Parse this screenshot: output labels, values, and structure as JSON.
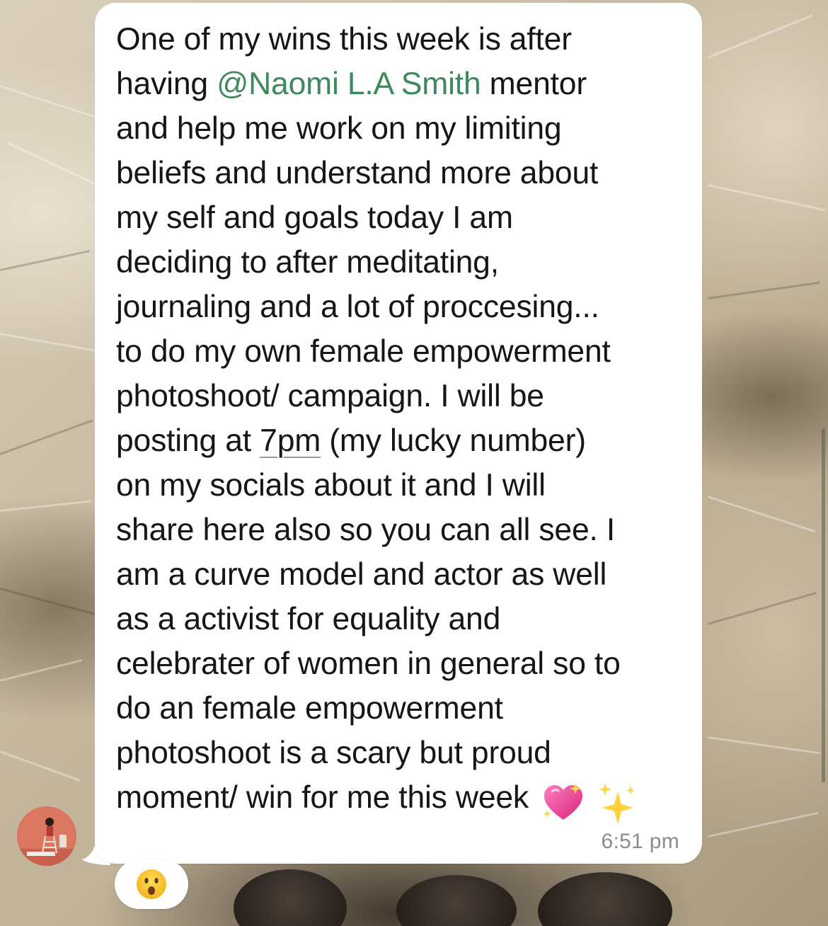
{
  "message": {
    "line_1": "One of my wins this week is after",
    "line_2_before": "having ",
    "mention": "@Naomi L.A Smith",
    "line_2_after": " mentor",
    "body_before_time": "and help me work on my limiting\nbeliefs and understand more about\nmy self and goals today I am\ndeciding to after meditating,\njournaling and a lot of proccesing...\nto do my own female empowerment\nphotoshoot/ campaign.  I will be\nposting at ",
    "time_link": "7pm",
    "body_after_time": " (my lucky number)\non my socials about it and I will\nshare here also so you can all see. I\nam a curve model and actor as well\nas a activist for equality and\ncelebrater of women in general so to\ndo an  female empowerment\nphotoshoot is a scary but proud\nmoment/ win for me this week",
    "emojis": [
      "sparkling-heart",
      "sparkles"
    ],
    "timestamp": "6:51 pm"
  },
  "reaction": {
    "emoji": "face-with-open-mouth"
  },
  "colors": {
    "mention": "#3f8a5c",
    "bubble": "#ffffff",
    "text": "#161616",
    "timestamp": "#8c8c8c"
  }
}
